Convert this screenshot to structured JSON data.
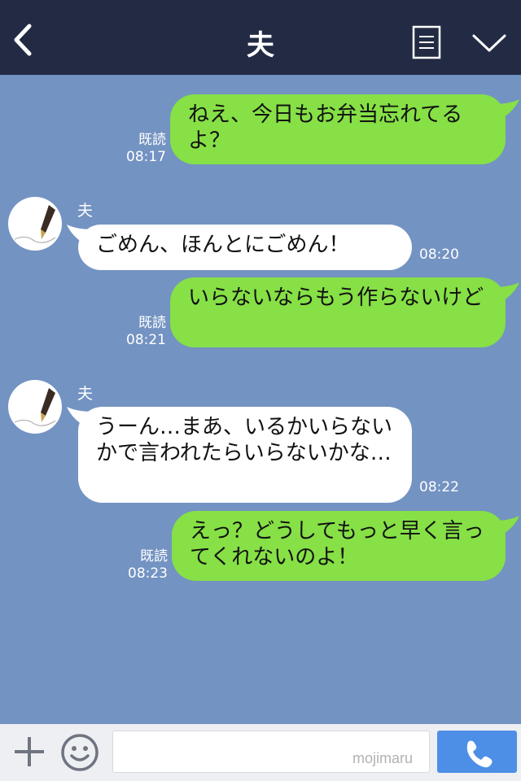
{
  "header": {
    "title": "夫"
  },
  "messages": [
    {
      "side": "out",
      "text": "ねえ、今日もお弁当忘れてるよ？",
      "read": "既読",
      "time": "08:17"
    },
    {
      "side": "in",
      "sender": "夫",
      "text": "ごめん、ほんとにごめん！",
      "time": "08:20"
    },
    {
      "side": "out",
      "text": "いらないならもう作らないけど",
      "read": "既読",
      "time": "08:21"
    },
    {
      "side": "in",
      "sender": "夫",
      "text": "うーん…まあ、いるかいらないかで言われたらいらないかな…",
      "time": "08:22"
    },
    {
      "side": "out",
      "text": "えっ？どうしてもっと早く言ってくれないのよ！",
      "read": "既読",
      "time": "08:23"
    }
  ],
  "composer": {
    "input_value": "",
    "watermark": "mojimaru"
  },
  "colors": {
    "header_bg": "#232b44",
    "chat_bg": "#7393c2",
    "outgoing_bubble": "#86e046",
    "incoming_bubble": "#ffffff",
    "call_button": "#4d8fe6"
  },
  "icons": {
    "back": "chevron-left-icon",
    "notes": "notes-icon",
    "menu": "chevron-down-icon",
    "add": "plus-icon",
    "emoji": "smiley-icon",
    "call": "phone-icon"
  }
}
